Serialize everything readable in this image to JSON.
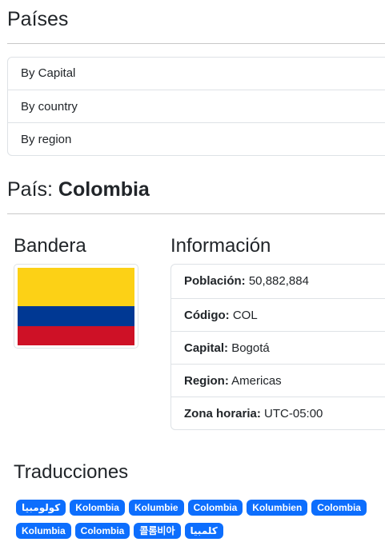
{
  "app": {
    "title": "Países"
  },
  "menu": {
    "items": [
      {
        "label": "By Capital"
      },
      {
        "label": "By country"
      },
      {
        "label": "By region"
      }
    ]
  },
  "country": {
    "heading_prefix": "País: ",
    "name": "Colombia"
  },
  "flag_section": {
    "title": "Bandera",
    "colors": {
      "yellow": "#FCD116",
      "blue": "#003893",
      "red": "#CE1126"
    }
  },
  "info": {
    "title": "Información",
    "rows": [
      {
        "key": "Población:",
        "value": "50,882,884"
      },
      {
        "key": "Código:",
        "value": "COL"
      },
      {
        "key": "Capital:",
        "value": "Bogotá"
      },
      {
        "key": "Region:",
        "value": "Americas"
      },
      {
        "key": "Zona horaria:",
        "value": "UTC-05:00"
      }
    ]
  },
  "translations": {
    "title": "Traducciones",
    "items": [
      "كولومبيا",
      "Kolombia",
      "Kolumbie",
      "Colombia",
      "Kolumbien",
      "Colombia",
      "Kolumbia",
      "Colombia",
      "콜롬비아",
      "کلمبیا"
    ]
  },
  "colors": {
    "accent": "#0d6efd",
    "border": "#dee2e6",
    "text": "#212529"
  }
}
